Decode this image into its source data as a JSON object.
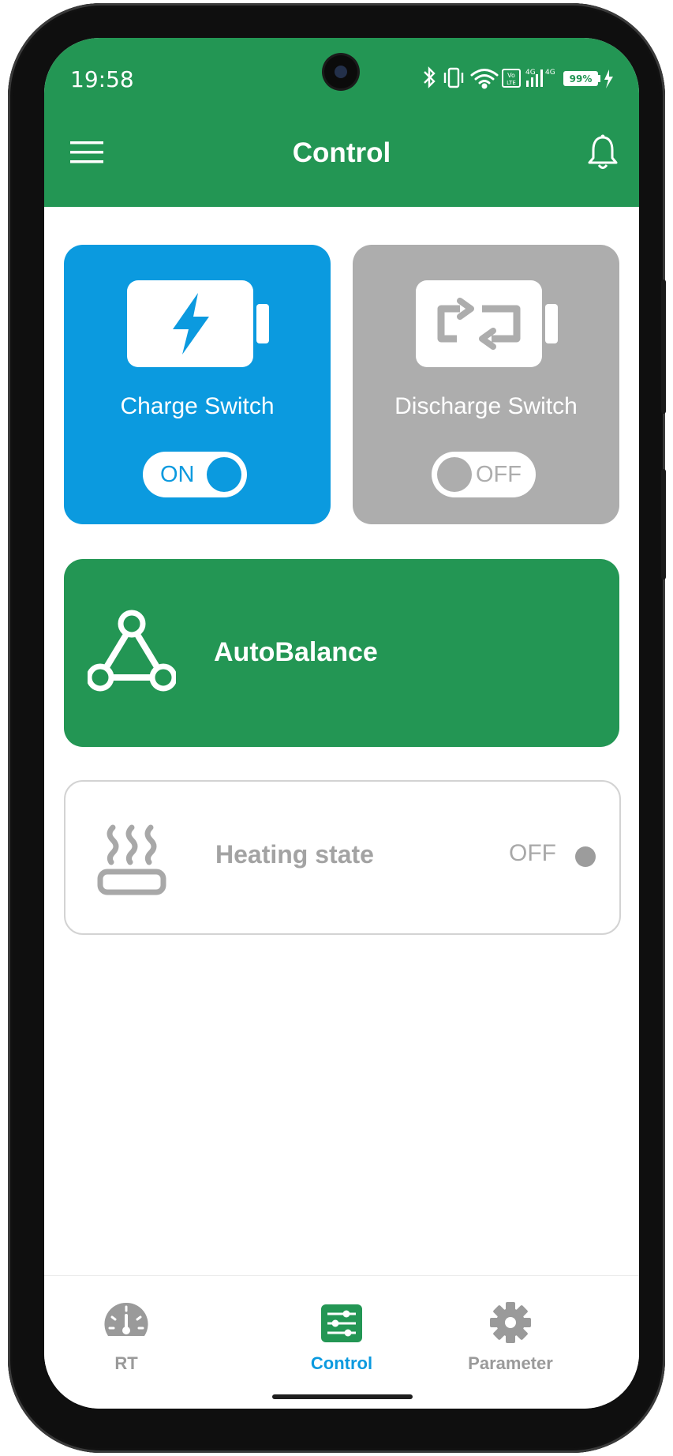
{
  "status_bar": {
    "time": "19:58",
    "battery_percent": "99",
    "network": "4G",
    "icons": [
      "bluetooth-icon",
      "vibrate-icon",
      "wifi-icon",
      "volte-icon",
      "signal-icon",
      "battery-icon",
      "charging-icon"
    ]
  },
  "header": {
    "title": "Control",
    "menu_icon": "hamburger-menu-icon",
    "bell_icon": "bell-icon"
  },
  "charge_card": {
    "label": "Charge Switch",
    "toggle_text": "ON",
    "state": "on",
    "color": "#0b9adf",
    "icon": "battery-charging-icon"
  },
  "discharge_card": {
    "label": "Discharge Switch",
    "toggle_text": "OFF",
    "state": "off",
    "color": "#adadad",
    "icon": "battery-discharge-icon"
  },
  "autobalance_card": {
    "label": "AutoBalance",
    "color": "#239654",
    "icon": "triangle-nodes-icon"
  },
  "heating_card": {
    "label": "Heating state",
    "state_text": "OFF",
    "icon": "heating-icon"
  },
  "bottom_nav": {
    "items": [
      {
        "label": "RT",
        "icon": "gauge-icon",
        "active": false
      },
      {
        "label": "Control",
        "icon": "sliders-icon",
        "active": true
      },
      {
        "label": "Parameter",
        "icon": "gear-icon",
        "active": false
      }
    ],
    "active_color": "#0b9adf",
    "inactive_color": "#9a9a9a"
  },
  "theme": {
    "brand_green": "#239654",
    "accent_blue": "#0b9adf"
  }
}
